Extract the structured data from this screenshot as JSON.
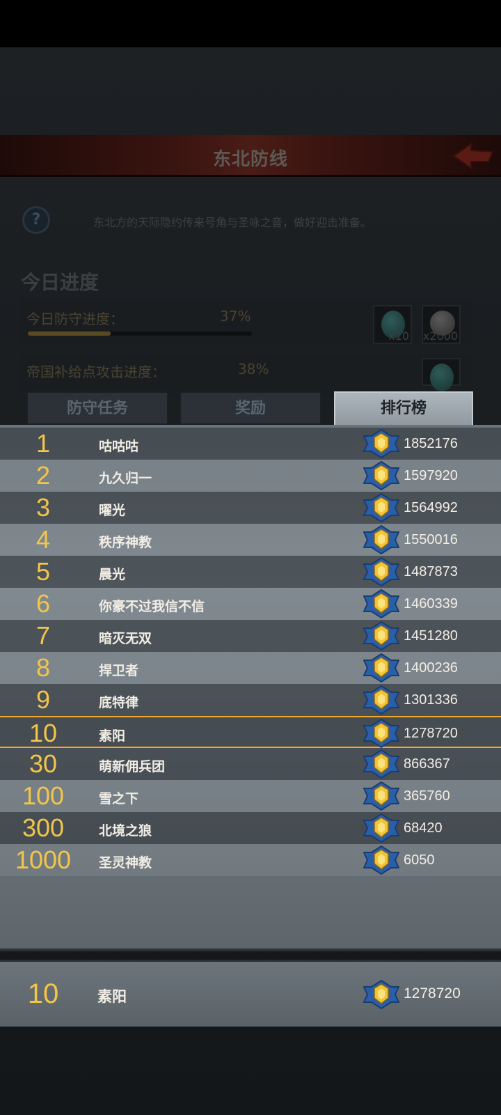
{
  "header": {
    "title": "东北防线"
  },
  "description": "东北方的天际隐约传来号角与圣咏之音，做好迎击准备。",
  "today": {
    "title": "今日进度",
    "defense": {
      "label": "今日防守进度：",
      "percent_text": "37%",
      "fill": 0.37
    },
    "attack": {
      "label": "帝国补给点攻击进度：",
      "percent_text": "38%",
      "fill": 0.38
    },
    "rewards": [
      {
        "icon": "gem-icon",
        "qty": "x10"
      },
      {
        "icon": "coin-icon",
        "qty": "x2000"
      }
    ]
  },
  "tabs": [
    {
      "label": "防守任务",
      "active": false
    },
    {
      "label": "奖励",
      "active": false
    },
    {
      "label": "排行榜",
      "active": true
    }
  ],
  "ranking": [
    {
      "rank": "1",
      "name": "咕咕咕",
      "score": "1852176"
    },
    {
      "rank": "2",
      "name": "九久归一",
      "score": "1597920"
    },
    {
      "rank": "3",
      "name": "曜光",
      "score": "1564992"
    },
    {
      "rank": "4",
      "name": "秩序神教",
      "score": "1550016"
    },
    {
      "rank": "5",
      "name": "晨光",
      "score": "1487873"
    },
    {
      "rank": "6",
      "name": "你豪不过我信不信",
      "score": "1460339"
    },
    {
      "rank": "7",
      "name": "暗灭无双",
      "score": "1451280"
    },
    {
      "rank": "8",
      "name": "捍卫者",
      "score": "1400236"
    },
    {
      "rank": "9",
      "name": "底特律",
      "score": "1301336"
    },
    {
      "rank": "10",
      "name": "素阳",
      "score": "1278720"
    },
    {
      "rank": "30",
      "name": "萌新佣兵团",
      "score": "866367"
    },
    {
      "rank": "100",
      "name": "雪之下",
      "score": "365760"
    },
    {
      "rank": "300",
      "name": "北境之狼",
      "score": "68420"
    },
    {
      "rank": "1000",
      "name": "圣灵神教",
      "score": "6050"
    }
  ],
  "my_rank": {
    "rank": "10",
    "name": "素阳",
    "score": "1278720"
  },
  "colors": {
    "rank_gold": "#f3c64a",
    "highlight": "#f0a830"
  }
}
